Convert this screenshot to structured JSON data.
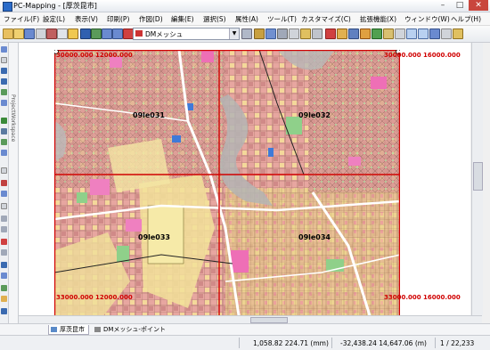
{
  "window": {
    "title": "PC-Mapping - [厚茨昆市]"
  },
  "menu": [
    "ファイル(F)",
    "設定(L)",
    "表示(V)",
    "印刷(P)",
    "作図(D)",
    "編集(E)",
    "選択(S)",
    "属性(A)",
    "ツール(T)",
    "カスタマイズ(C)",
    "拡張機能(X)",
    "ウィンドウ(W)",
    "ヘルプ(H)"
  ],
  "toolbar": {
    "layer_select_value": "DMメッシュ"
  },
  "side_panel": {
    "label": "ProjectWorkspace"
  },
  "map": {
    "coords": {
      "top_left": "30000.000 12000.000",
      "top_right": "30000.000 16000.000",
      "bottom_left": "33000.000 12000.000",
      "bottom_right": "33000.000 16000.000"
    },
    "meshes": [
      "09le031",
      "09le032",
      "09le033",
      "09le034"
    ]
  },
  "tabs": [
    "厚茨昆市",
    "DMメッシュ-ポイント"
  ],
  "status": {
    "coord1": "1,058.82 224.71 (mm)",
    "coord2": "-32,438.24 14,647.06 (m)",
    "page": "1 / 22,233"
  },
  "colors": {
    "grid_red": "#d00000",
    "accent": "#2a6bc9"
  }
}
